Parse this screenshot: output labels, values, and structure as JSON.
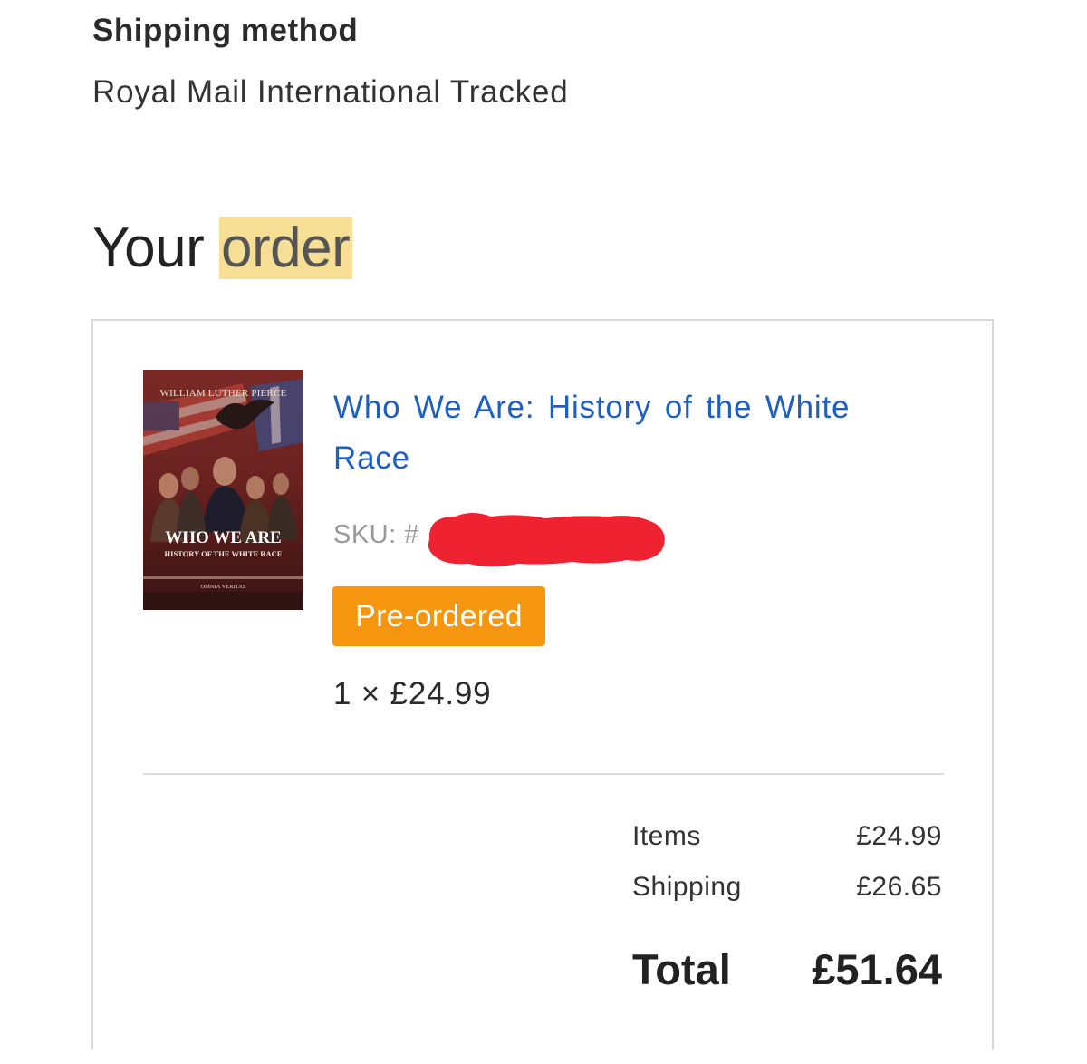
{
  "shipping": {
    "heading": "Shipping method",
    "method": "Royal Mail International Tracked"
  },
  "order": {
    "heading_prefix": "Your ",
    "heading_highlight": "order"
  },
  "item": {
    "cover": {
      "author": "WILLIAM LUTHER PIERCE",
      "title": "WHO WE ARE",
      "subtitle": "HISTORY OF THE WHITE RACE",
      "publisher": "OMNIA VERITAS"
    },
    "title": "Who We Are: History of the White Race",
    "sku_label": "SKU: #",
    "status": "Pre-ordered",
    "status_color": "#f6960f",
    "quantity_price": "1 × £24.99"
  },
  "summary": {
    "items_label": "Items",
    "items_value": "£24.99",
    "shipping_label": "Shipping",
    "shipping_value": "£26.65",
    "total_label": "Total",
    "total_value": "£51.64"
  },
  "colors": {
    "link": "#1f5fbf",
    "highlight": "#f6df95",
    "redaction": "#ee2230"
  }
}
